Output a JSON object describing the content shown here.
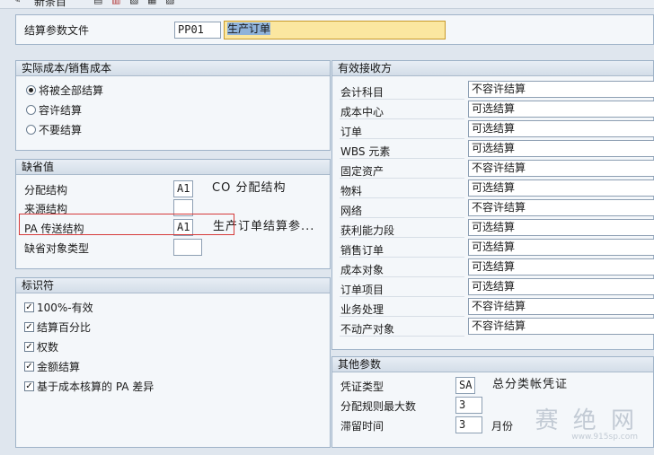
{
  "toolbar": {
    "label": "新条目"
  },
  "header": {
    "param_file_label": "结算参数文件",
    "param_file_code": "PP01",
    "param_file_desc": "生产订单"
  },
  "actual_cost": {
    "title": "实际成本/销售成本",
    "options": [
      {
        "label": "将被全部结算",
        "selected": true
      },
      {
        "label": "容许结算",
        "selected": false
      },
      {
        "label": "不要结算",
        "selected": false
      }
    ]
  },
  "defaults": {
    "title": "缺省值",
    "alloc_struct_label": "分配结构",
    "alloc_struct_value": "A1",
    "alloc_struct_desc": "CO 分配结构",
    "source_struct_label": "来源结构",
    "source_struct_value": "",
    "pa_struct_label": "PA 传送结构",
    "pa_struct_value": "A1",
    "pa_struct_desc": "生产订单结算参...",
    "default_obj_label": "缺省对象类型",
    "default_obj_value": ""
  },
  "indicators": {
    "title": "标识符",
    "items": [
      {
        "label": "100%-有效",
        "checked": true
      },
      {
        "label": "结算百分比",
        "checked": true
      },
      {
        "label": "权数",
        "checked": true
      },
      {
        "label": "金额结算",
        "checked": true
      },
      {
        "label": "基于成本核算的 PA 差异",
        "checked": true
      }
    ]
  },
  "receivers": {
    "title": "有效接收方",
    "rows": [
      {
        "label": "会计科目",
        "value": "不容许结算"
      },
      {
        "label": "成本中心",
        "value": "可选结算"
      },
      {
        "label": "订单",
        "value": "可选结算"
      },
      {
        "label": "WBS 元素",
        "value": "可选结算"
      },
      {
        "label": "固定资产",
        "value": "不容许结算"
      },
      {
        "label": "物料",
        "value": "可选结算"
      },
      {
        "label": "网络",
        "value": "不容许结算"
      },
      {
        "label": "获利能力段",
        "value": "可选结算"
      },
      {
        "label": "销售订单",
        "value": "可选结算"
      },
      {
        "label": "成本对象",
        "value": "可选结算"
      },
      {
        "label": "订单项目",
        "value": "可选结算"
      },
      {
        "label": "业务处理",
        "value": "不容许结算"
      },
      {
        "label": "不动产对象",
        "value": "不容许结算"
      }
    ]
  },
  "other": {
    "title": "其他参数",
    "doc_type_label": "凭证类型",
    "doc_type_value": "SA",
    "doc_type_desc": "总分类帐凭证",
    "max_rules_label": "分配规则最大数",
    "max_rules_value": "3",
    "retention_label": "滞留时间",
    "retention_value": "3",
    "retention_unit": "月份"
  },
  "watermark": {
    "text": "赛 绝 网",
    "url": "www.915sp.com"
  },
  "colors": {
    "panel_border": "#9fb3c8",
    "desc_highlight": "#fbe7a0",
    "callout": "#d63a3a"
  }
}
